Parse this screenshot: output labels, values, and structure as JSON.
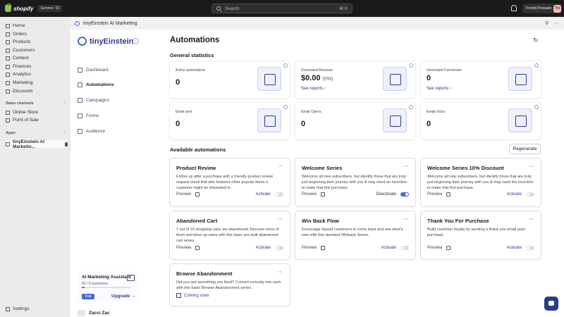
{
  "topbar": {
    "logo_text": "shopify",
    "summer_badge": "Summer '23",
    "search_placeholder": "Search",
    "search_shortcut": "⌘ K",
    "store_name": "TrendyThreads",
    "store_initials": "Tm"
  },
  "nav": {
    "items": [
      "Home",
      "Orders",
      "Products",
      "Customers",
      "Content",
      "Finances",
      "Analytics",
      "Marketing",
      "Discounts"
    ],
    "sales_channels_label": "Sales channels",
    "sales_channels": [
      "Online Store",
      "Point of Sale"
    ],
    "apps_label": "Apps",
    "apps": [
      "tinyEinstein AI Marketin..."
    ],
    "settings": "Settings"
  },
  "header": {
    "title": "tinyEinstein AI Marketing"
  },
  "panel": {
    "brand": "tinyEinstein",
    "menu": [
      "Dashboard",
      "Automations",
      "Campaigns",
      "Forms",
      "Audience"
    ],
    "assistant_title": "AI Marketing Assistant",
    "assistant_count": "83 / 0 customers",
    "assistant_progress": 0.05,
    "trial": "Trial",
    "upgrade": "Upgrade",
    "user": "Zacci Zac"
  },
  "page": {
    "title": "Automations",
    "general_stats": "General statistics",
    "available": "Available automations",
    "regenerate": "Regenerate"
  },
  "stats": [
    {
      "label": "Active automations",
      "value": "0",
      "pct": "",
      "link": ""
    },
    {
      "label": "Generated Revenue",
      "value": "$0.00",
      "pct": "(0%)",
      "link": "See reports"
    },
    {
      "label": "Generated Conversion",
      "value": "0",
      "pct": "",
      "link": "See reports"
    },
    {
      "label": "Email sent",
      "value": "0",
      "pct": "",
      "link": ""
    },
    {
      "label": "Email Opens",
      "value": "0",
      "pct": "",
      "link": ""
    },
    {
      "label": "Email clicks",
      "value": "0",
      "pct": "",
      "link": ""
    }
  ],
  "cards": [
    {
      "title": "Product Review",
      "desc": "Follow up after a purchase with a friendly product review request email that also features other popular items a customer might be interested in.",
      "preview": "Preview",
      "action": "Activate",
      "on": false
    },
    {
      "title": "Welcome Series",
      "desc": "Welcome all new subscribers, but identify those that are truly just beginning their journey with you & may need an incentive to make that first purchase.",
      "preview": "Preview",
      "action": "Deactivate",
      "on": true
    },
    {
      "title": "Welcome Series 10% Discount",
      "desc": "Welcome all new subscribers, but identify those that are truly just beginning their journey with you & may need the incentive to make that first purchase.",
      "preview": "Preview",
      "action": "Activate",
      "on": false
    },
    {
      "title": "Abandoned Cart",
      "desc": "7 out of 10 shopping carts are abandoned. Recover more of them and drive up sales with this basic pre-built abandoned cart series.",
      "preview": "Preview",
      "action": "Activate",
      "on": false
    },
    {
      "title": "Win Back Flow",
      "desc": "Encourage lapsed customers to come back and see what's new with this standard Winback Series.",
      "preview": "Preview",
      "action": "Activate",
      "on": false
    },
    {
      "title": "Thank You For Purchase",
      "desc": "Build customer loyalty by sending a thank you email post-purchase.",
      "preview": "Preview",
      "action": "Activate",
      "on": false
    },
    {
      "title": "Browse Abandonment",
      "desc": "Did you see something you liked? Convert curiosity into cash with this basic Browse Abandonment series.",
      "preview": "",
      "action": "Coming soon",
      "on": false
    }
  ]
}
